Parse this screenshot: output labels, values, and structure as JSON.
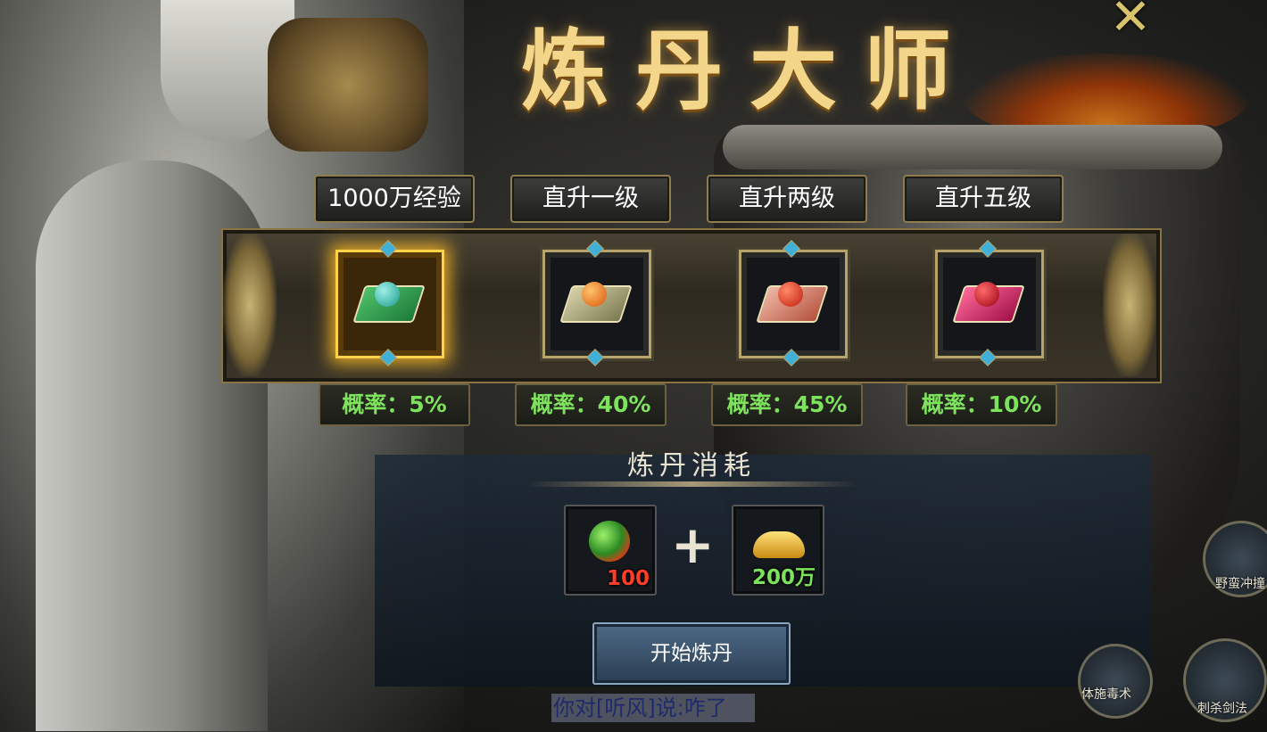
{
  "header": {
    "title": "炼丹大师",
    "close_icon": "close-x-icon"
  },
  "tabs": [
    {
      "label": "1000万经验"
    },
    {
      "label": "直升一级"
    },
    {
      "label": "直升两级"
    },
    {
      "label": "直升五级"
    }
  ],
  "slots": [
    {
      "item": "green-pill-icon",
      "rate": "概率：5%",
      "selected": true
    },
    {
      "item": "orange-pill-icon",
      "rate": "概率：40%",
      "selected": false
    },
    {
      "item": "red-pill-icon",
      "rate": "概率：45%",
      "selected": false
    },
    {
      "item": "crimson-pill-icon",
      "rate": "概率：10%",
      "selected": false
    }
  ],
  "cost": {
    "title": "炼丹消耗",
    "items": [
      {
        "icon": "elixir-gem-icon",
        "qty": "100",
        "qty_color": "#ff3b2a"
      },
      {
        "icon": "gold-ingot-icon",
        "qty": "200万",
        "qty_color": "#7ee35c"
      }
    ],
    "plus": "+"
  },
  "start_button": "开始炼丹",
  "chat_line": "你对[听风]说:咋了",
  "skills": [
    {
      "label": "野蛮冲撞"
    },
    {
      "label": "刺杀剑法"
    },
    {
      "label": "体施毒术"
    }
  ]
}
